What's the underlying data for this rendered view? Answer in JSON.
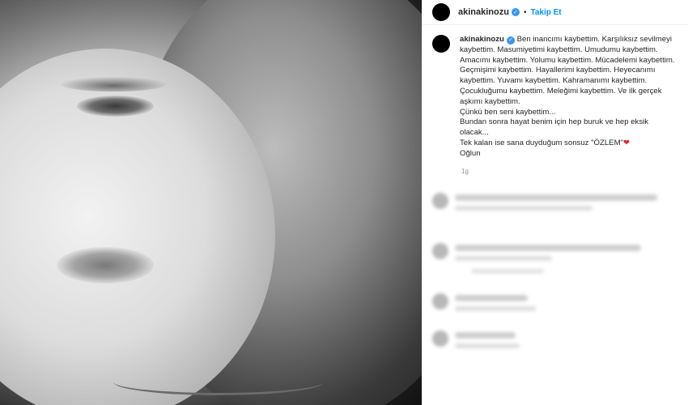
{
  "header": {
    "username": "akinakinozu",
    "separator": "•",
    "follow_label": "Takip Et"
  },
  "post": {
    "username": "akinakinozu",
    "caption_lines": [
      "Ben inancımı kaybettim. Karşılıksız sevilmeyi",
      "kaybettim. Masumiyetimi kaybettim. Umudumu kaybettim.",
      "Amacımı kaybettim. Yolumu kaybettim. Mücadelemi kaybettim.",
      "Geçmişimi kaybettim. Hayallerimi kaybettim. Heyecanımı",
      "kaybettim. Yuvamı kaybettim. Kahramanımı kaybettim.",
      "Çocukluğumu kaybettim. Meleğimi kaybettim. Ve ilk gerçek",
      "aşkımı kaybettim.",
      "Çünkü ben seni kaybettim...",
      "Bundan sonra hayat benim için hep buruk ve hep eksik olacak...",
      "Tek kalan ise sana duyduğum sonsuz \"ÖZLEM\"",
      "Oğlun"
    ],
    "heart_glyph": "❤",
    "time_ago": "1g"
  },
  "colors": {
    "follow": "#0095f6",
    "verified": "#3897f0",
    "heart": "#ed1c24"
  }
}
